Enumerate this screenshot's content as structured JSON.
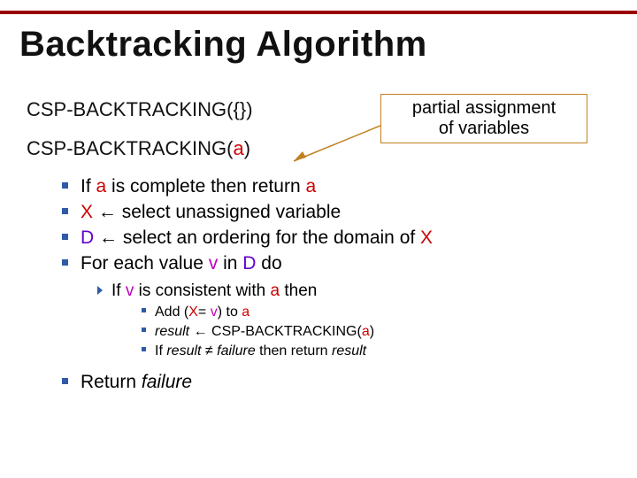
{
  "title": "Backtracking Algorithm",
  "call1_pre": "CSP-BACKTRACKING(",
  "call1_arg": "{}",
  "call1_post": ")",
  "call2_pre": "CSP-BACKTRACKING(",
  "call2_arg": "a",
  "call2_post": ")",
  "notebox_l1": "partial assignment",
  "notebox_l2": "of variables",
  "b1": {
    "p1": "If ",
    "a1": "a",
    "p2": " is complete then return ",
    "a2": "a"
  },
  "b2": {
    "x": "X",
    "arrow": " ← ",
    "rest": "select unassigned variable"
  },
  "b3": {
    "d": "D",
    "arrow": " ← ",
    "rest1": "select an ordering for the domain of ",
    "x": "X"
  },
  "b4": {
    "p1": "For each value ",
    "v": "v",
    "p2": " in ",
    "d": "D",
    "p3": " do"
  },
  "s1": {
    "p1": "If ",
    "v": "v",
    "p2": " is consistent with ",
    "a": "a",
    "p3": " then"
  },
  "t1": {
    "p1": "Add (",
    "x": "X",
    "eq": "= ",
    "v": "v",
    "p2": ") to ",
    "a": "a"
  },
  "t2": {
    "r": "result",
    "arrow": " ← ",
    "call": "CSP-BACKTRACKING(",
    "a": "a",
    "post": ")"
  },
  "t3": {
    "p1": "If ",
    "r1": "result",
    "neq": " ≠ ",
    "fail": "failure",
    "p2": " then return ",
    "r2": "result"
  },
  "ret": {
    "p1": "Return ",
    "fail": "failure"
  }
}
